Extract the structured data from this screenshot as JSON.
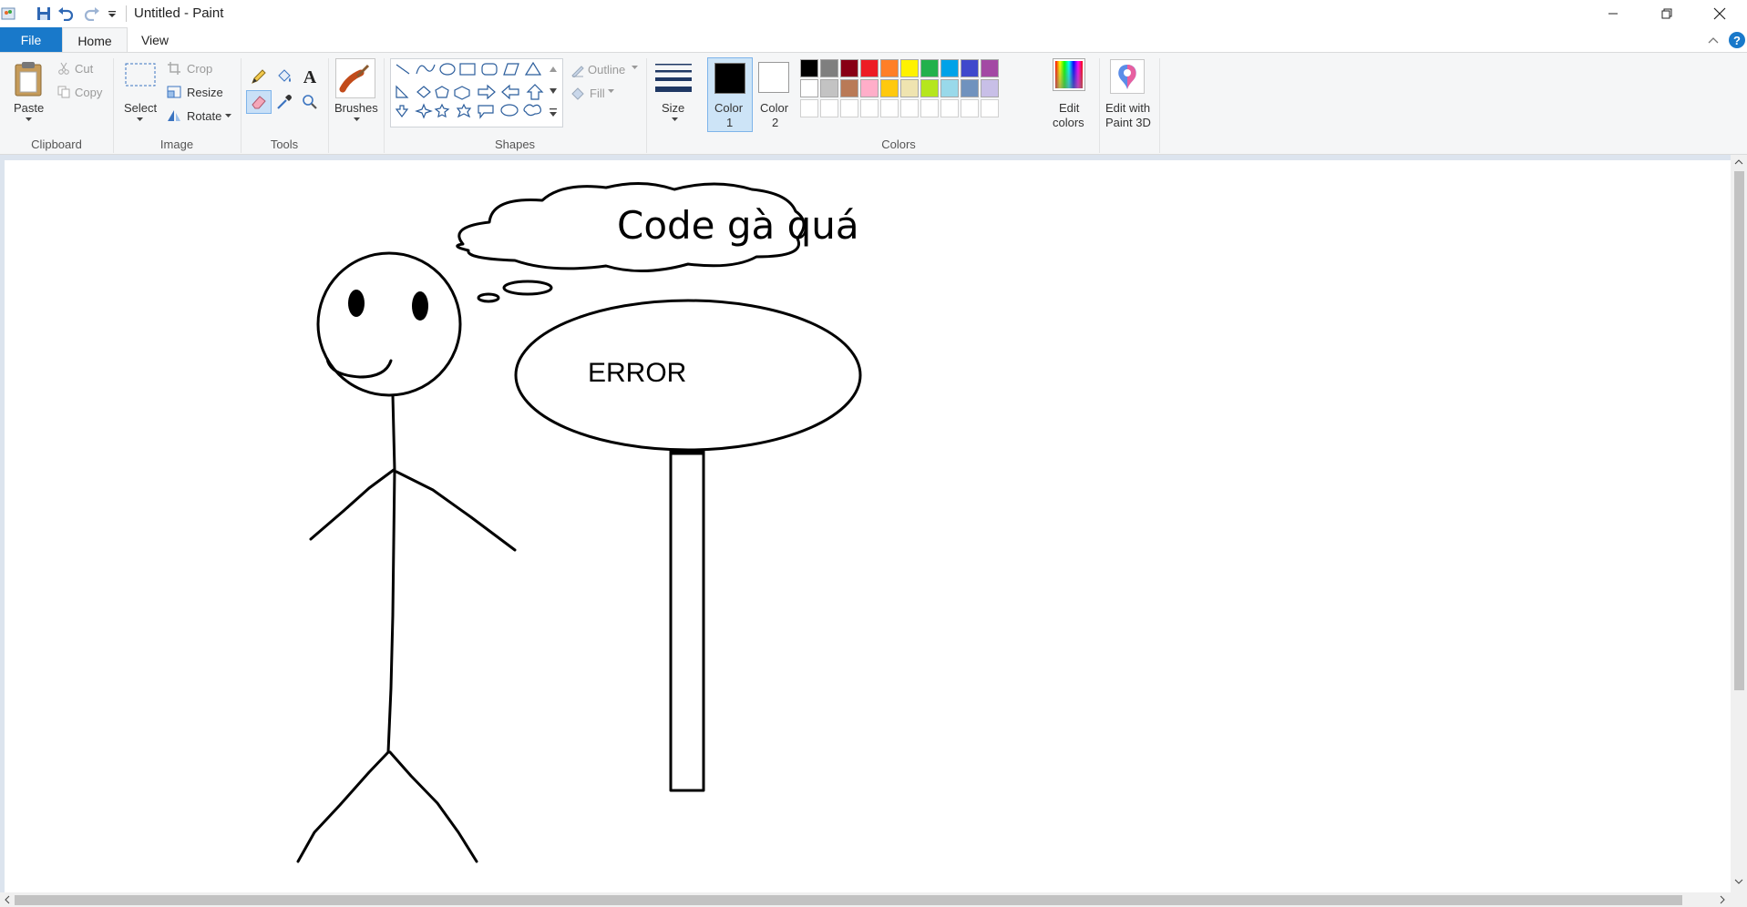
{
  "window": {
    "title": "Untitled - Paint"
  },
  "quick_access": [
    "save-icon",
    "undo-icon",
    "redo-icon",
    "customize-dropdown-icon"
  ],
  "tabs": {
    "file": "File",
    "home": "Home",
    "view": "View"
  },
  "clipboard": {
    "paste": "Paste",
    "cut": "Cut",
    "copy": "Copy",
    "group": "Clipboard"
  },
  "image": {
    "select": "Select",
    "crop": "Crop",
    "resize": "Resize",
    "rotate": "Rotate",
    "group": "Image"
  },
  "tools": {
    "group": "Tools",
    "brushes": "Brushes"
  },
  "shapes": {
    "outline": "Outline",
    "fill": "Fill",
    "group": "Shapes"
  },
  "size": {
    "label": "Size"
  },
  "colors": {
    "color1_line1": "Color",
    "color1_line2": "1",
    "color2_line1": "Color",
    "color2_line2": "2",
    "color1_value": "#000000",
    "color2_value": "#ffffff",
    "edit_line1": "Edit",
    "edit_line2": "colors",
    "paint3d_line1": "Edit with",
    "paint3d_line2": "Paint 3D",
    "group": "Colors",
    "palette_row1": [
      "#000000",
      "#7f7f7f",
      "#880015",
      "#ed1c24",
      "#ff7f27",
      "#fff200",
      "#22b14c",
      "#00a2e8",
      "#3f48cc",
      "#a349a4"
    ],
    "palette_row2": [
      "#ffffff",
      "#c3c3c3",
      "#b97a57",
      "#ffaec9",
      "#ffc90e",
      "#efe4b0",
      "#b5e61d",
      "#99d9ea",
      "#7092be",
      "#c8bfe7"
    ]
  },
  "drawing": {
    "thought_text": "Code gà quá",
    "sign_text": "ERROR"
  }
}
